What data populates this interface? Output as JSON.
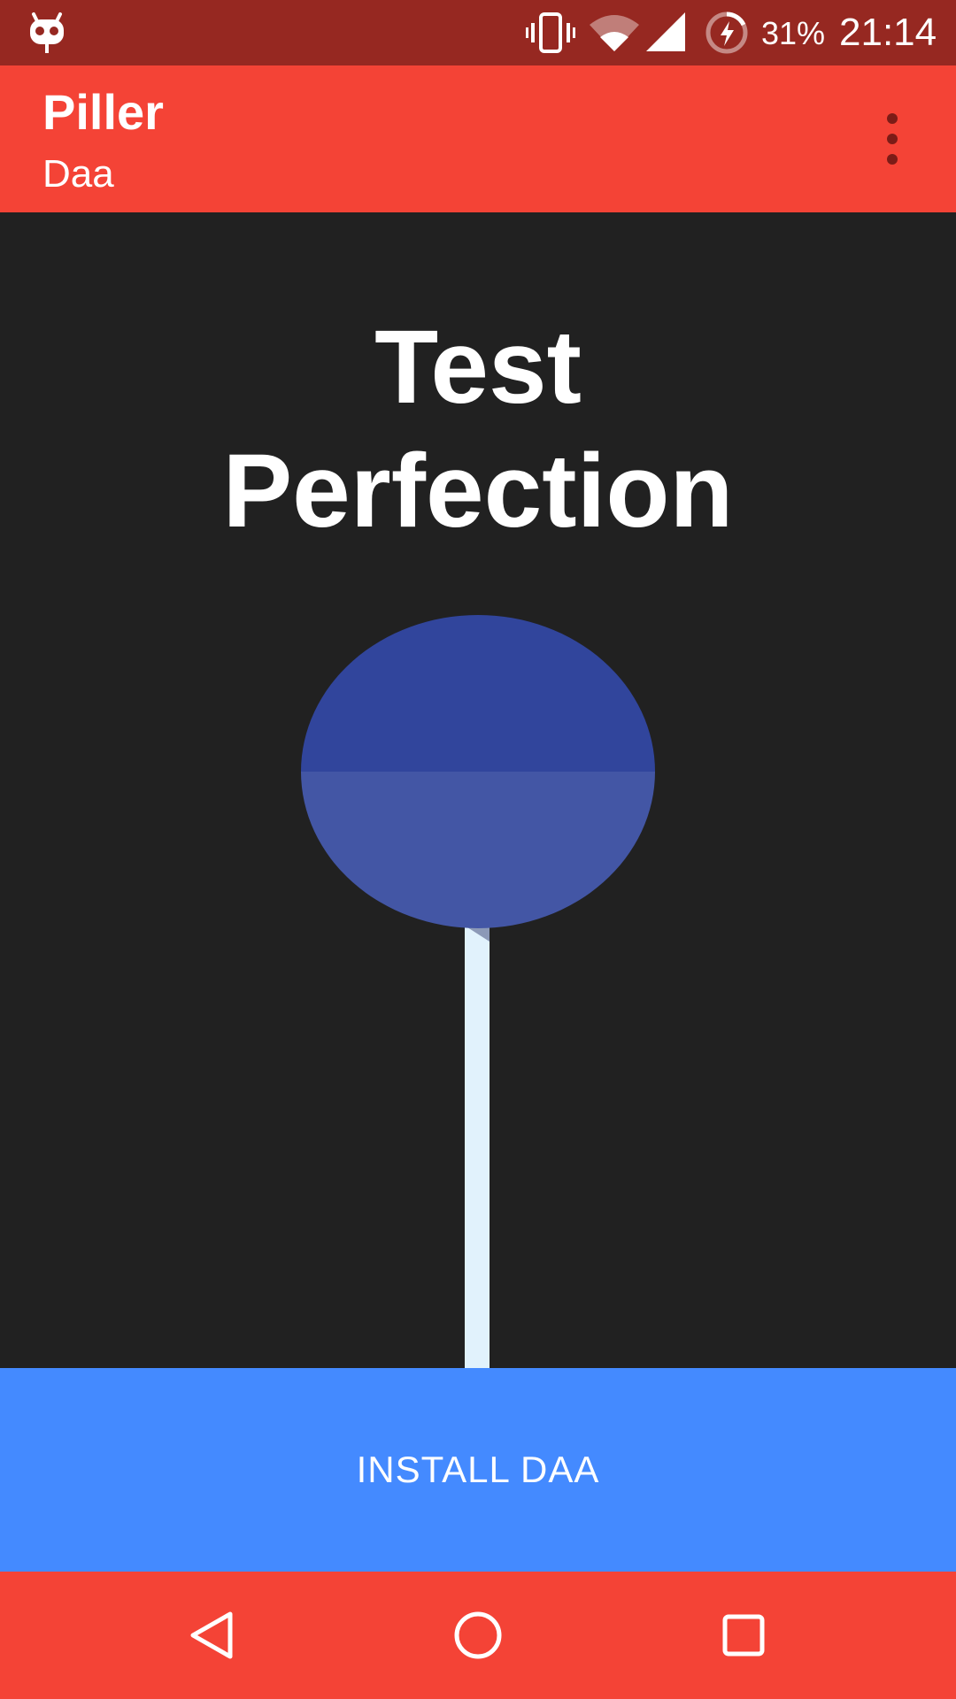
{
  "status_bar": {
    "battery_percent": "31%",
    "time": "21:14",
    "icons": [
      "cyanogenmod-icon",
      "vibrate-icon",
      "wifi-icon",
      "cell-signal-icon",
      "battery-charging-icon"
    ]
  },
  "app_bar": {
    "title": "Piller",
    "subtitle": "Daa",
    "overflow_icon": "more-vert-icon"
  },
  "hero": {
    "title_line1": "Test",
    "title_line2": "Perfection",
    "illustration": "lollipop"
  },
  "install_button": {
    "label": "INSTALL DAA"
  },
  "nav_bar": {
    "buttons": [
      "back-icon",
      "home-icon",
      "recents-icon"
    ]
  },
  "colors": {
    "status_bar": "#962821",
    "app_bar": "#f44336",
    "background": "#212121",
    "lollipop_top": "#31459c",
    "lollipop_bottom": "#4356a5",
    "stick": "#e1f2fc",
    "install_button": "#448aff",
    "nav_bar": "#f44336"
  }
}
